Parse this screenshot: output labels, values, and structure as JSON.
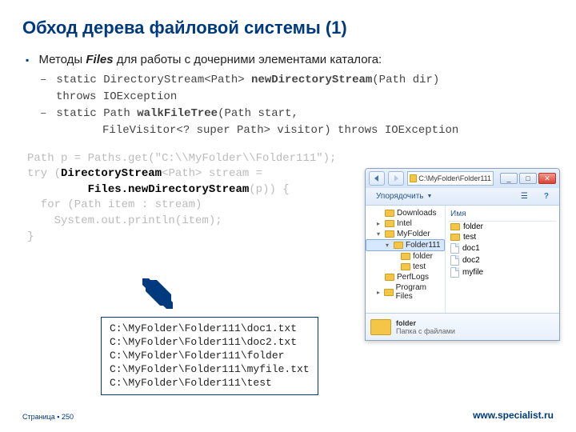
{
  "title": "Обход дерева файловой системы (1)",
  "bullet": {
    "pre": "Методы ",
    "boldword": "Files",
    "post": " для работы с дочерними элементами каталога:"
  },
  "sig1": {
    "a": "static DirectoryStream<Path> ",
    "b": "newDirectoryStream",
    "c": "(Path dir)",
    "d": "throws IOException"
  },
  "sig2": {
    "a": "static Path ",
    "b": "walkFileTree",
    "c": "(Path start,",
    "d": "FileVisitor<? super Path> visitor) throws IOException"
  },
  "code": {
    "l1a": "Path p = Paths.get(\"C:\\\\MyFolder\\\\Folder111\");",
    "l2a": "try (",
    "l2b": "DirectoryStream",
    "l2c": "<Path> stream =",
    "l3a": "         ",
    "l3b": "Files.newDirectoryStream",
    "l3c": "(p)) {",
    "l4": "  for (Path item : stream)",
    "l5": "    System.out.println(item);",
    "l6": "}"
  },
  "output": [
    "C:\\MyFolder\\Folder111\\doc1.txt",
    "C:\\MyFolder\\Folder111\\doc2.txt",
    "C:\\MyFolder\\Folder111\\folder",
    "C:\\MyFolder\\Folder111\\myfile.txt",
    "C:\\MyFolder\\Folder111\\test"
  ],
  "explorer": {
    "path": "C:\\MyFolder\\Folder111",
    "organize": "Упорядочить",
    "colname": "Имя",
    "tree": [
      "Downloads",
      "Intel",
      "MyFolder",
      "Folder111",
      "folder",
      "test",
      "PerfLogs",
      "Program Files"
    ],
    "files": [
      "folder",
      "test",
      "doc1",
      "doc2",
      "myfile"
    ],
    "preview_name": "folder",
    "preview_desc": "Папка с файлами"
  },
  "footer": {
    "page_label": "Страница ▪ ",
    "page_num": "250",
    "site": "www.specialist.ru"
  }
}
